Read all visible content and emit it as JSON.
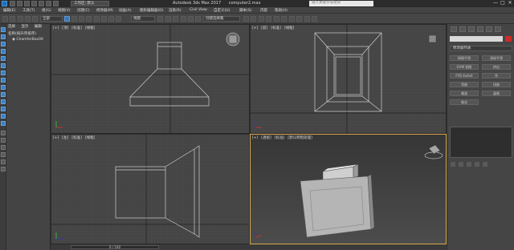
{
  "window": {
    "title": "Autodesk 3ds Max 2017",
    "file": "computer2.max",
    "workspace": "工作区: 默认",
    "search_placeholder": "键入关键字或短语",
    "minimize": "—",
    "maximize": "□",
    "close": "✕"
  },
  "menu": [
    "编辑(E)",
    "工具(T)",
    "组(G)",
    "视图(V)",
    "创建(C)",
    "修改器(M)",
    "动画(A)",
    "图形编辑器(D)",
    "渲染(R)",
    "Civil View",
    "自定义(U)",
    "脚本(S)",
    "内容",
    "帮助(H)"
  ],
  "toolbar": {
    "filter": "全部",
    "view": "视图",
    "selection_set": "创建选择集"
  },
  "scene_explorer": {
    "tabs": [
      "选择",
      "显示",
      "编辑"
    ],
    "root": "名称(按升序排序)",
    "object": "ChamferBox0X"
  },
  "viewports": {
    "top": [
      "[+]",
      "[顶]",
      "[标准]",
      "[线框]"
    ],
    "front": [
      "[+]",
      "[前]",
      "[标准]",
      "[线框]"
    ],
    "left": [
      "[+]",
      "[左]",
      "[标准]",
      "[线框]"
    ],
    "perspective": [
      "[+]",
      "[透视]",
      "[标准]",
      "[默认明暗处理]"
    ]
  },
  "command_panel": {
    "modifier_list": "修改器列表",
    "buttons": [
      "网格平滑",
      "涡轮平滑",
      "UVW 贴图",
      "挤出",
      "FFD 4x4x4",
      "壳",
      "弯曲",
      "扭曲",
      "噪波",
      "晶格",
      "锥化"
    ]
  },
  "status": {
    "frame": "0 / 100"
  },
  "colors": {
    "accent": "#d6a94a",
    "object_color": "#d02a2a"
  }
}
